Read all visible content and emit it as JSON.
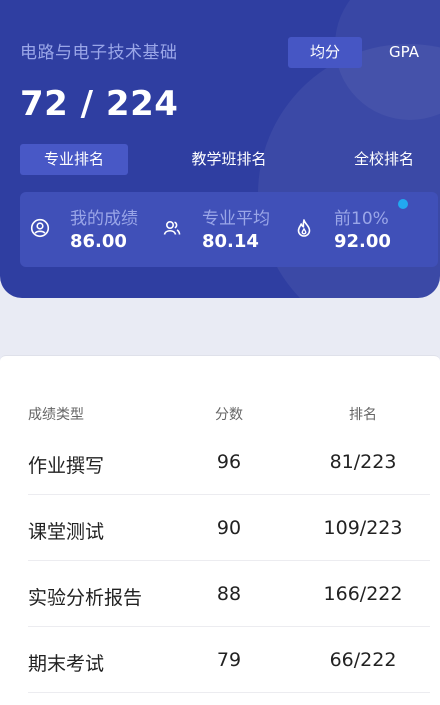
{
  "header": {
    "course_title": "电路与电子技术基础",
    "mode_toggle": {
      "active": "均分",
      "inactive": "GPA"
    },
    "rank_summary": "72 / 224",
    "tabs": [
      {
        "label": "专业排名",
        "active": true
      },
      {
        "label": "教学班排名",
        "active": false
      },
      {
        "label": "全校排名",
        "active": false
      }
    ],
    "stats": [
      {
        "label": "我的成绩",
        "value": "86.00",
        "icon": "user-icon"
      },
      {
        "label": "专业平均",
        "value": "80.14",
        "icon": "group-icon"
      },
      {
        "label": "前10%",
        "value": "92.00",
        "icon": "flame-icon"
      }
    ]
  },
  "table": {
    "headers": {
      "type": "成绩类型",
      "score": "分数",
      "rank": "排名"
    },
    "rows": [
      {
        "type": "作业撰写",
        "score": "96",
        "rank": "81/223"
      },
      {
        "type": "课堂测试",
        "score": "90",
        "rank": "109/223"
      },
      {
        "type": "实验分析报告",
        "score": "88",
        "rank": "166/222"
      },
      {
        "type": "期末考试",
        "score": "79",
        "rank": "66/222"
      }
    ]
  },
  "colors": {
    "header_bg": "#2f3ea1",
    "accent": "#4858c6",
    "indicator_dot": "#22a9f0"
  }
}
